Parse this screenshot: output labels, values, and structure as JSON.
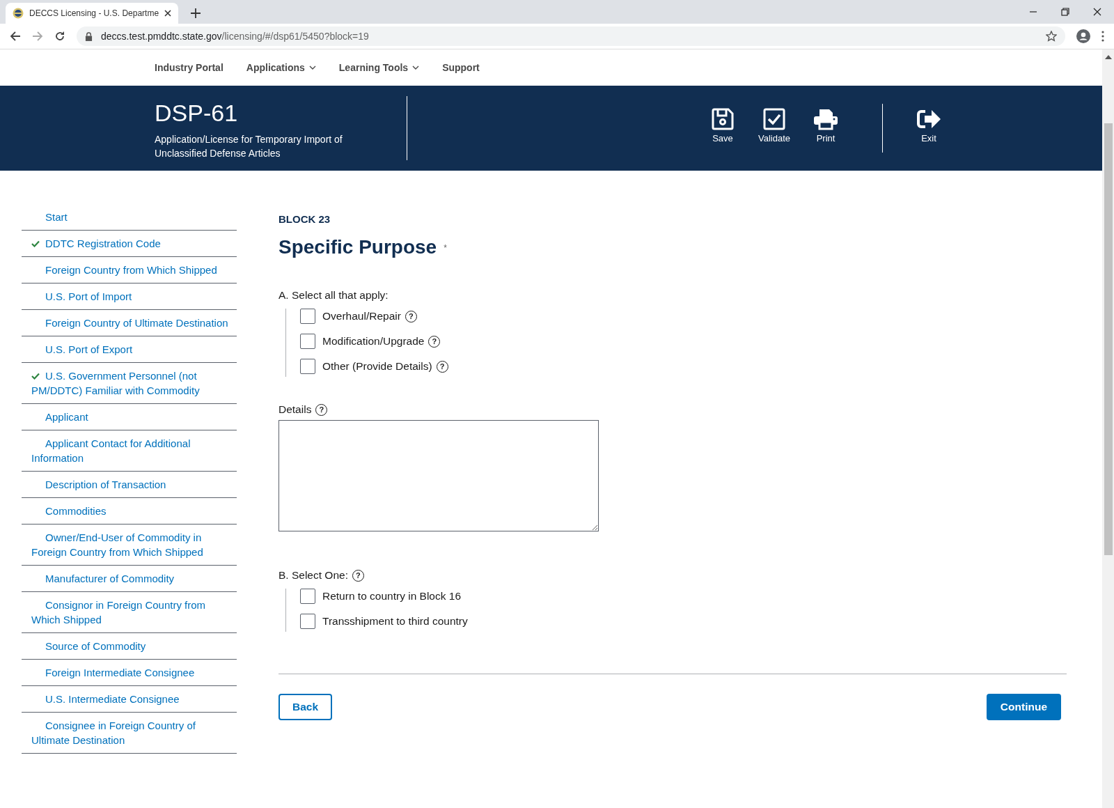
{
  "browser": {
    "tab_title": "DECCS Licensing - U.S. Departme",
    "url_host": "deccs.test.pmddtc.state.gov",
    "url_path": "/licensing/#/dsp61/5450?block=19"
  },
  "nav": [
    {
      "label": "Industry Portal",
      "dropdown": false
    },
    {
      "label": "Applications",
      "dropdown": true
    },
    {
      "label": "Learning Tools",
      "dropdown": true
    },
    {
      "label": "Support",
      "dropdown": false
    }
  ],
  "header": {
    "form": "DSP-61",
    "subtitle": "Application/License for Temporary Import of Unclassified Defense Articles",
    "actions": [
      {
        "kind": "save",
        "label": "Save"
      },
      {
        "kind": "validate",
        "label": "Validate"
      },
      {
        "kind": "print",
        "label": "Print"
      }
    ],
    "exit": {
      "kind": "exit",
      "label": "Exit"
    }
  },
  "sidebar": {
    "items": [
      {
        "label": "Start",
        "checked": false
      },
      {
        "label": "DDTC Registration Code",
        "checked": true
      },
      {
        "label": "Foreign Country from Which Shipped",
        "checked": false
      },
      {
        "label": "U.S. Port of Import",
        "checked": false
      },
      {
        "label": "Foreign Country of Ultimate Destination",
        "checked": false
      },
      {
        "label": "U.S. Port of Export",
        "checked": false
      },
      {
        "label": "U.S. Government Personnel (not PM/DDTC) Familiar with Commodity",
        "checked": true
      },
      {
        "label": "Applicant",
        "checked": false
      },
      {
        "label": "Applicant Contact for Additional Information",
        "checked": false
      },
      {
        "label": "Description of Transaction",
        "checked": false
      },
      {
        "label": "Commodities",
        "checked": false
      },
      {
        "label": "Owner/End-User of Commodity in Foreign Country from Which Shipped",
        "checked": false
      },
      {
        "label": "Manufacturer of Commodity",
        "checked": false
      },
      {
        "label": "Consignor in Foreign Country from Which Shipped",
        "checked": false
      },
      {
        "label": "Source of Commodity",
        "checked": false
      },
      {
        "label": "Foreign Intermediate Consignee",
        "checked": false
      },
      {
        "label": "U.S. Intermediate Consignee",
        "checked": false
      },
      {
        "label": "Consignee in Foreign Country of Ultimate Destination",
        "checked": false
      }
    ]
  },
  "form": {
    "block": "BLOCK 23",
    "title": "Specific Purpose",
    "required_mark": "*",
    "section_a": {
      "label": "A. Select all that apply:",
      "options": [
        {
          "label": "Overhaul/Repair",
          "checked": false,
          "help": "?"
        },
        {
          "label": "Modification/Upgrade",
          "checked": false,
          "help": "?"
        },
        {
          "label": "Other (Provide Details)",
          "checked": false,
          "help": "?"
        }
      ]
    },
    "details": {
      "label": "Details",
      "help": "?"
    },
    "section_b": {
      "label": "B. Select One:",
      "help": "?",
      "options": [
        {
          "label": "Return to country in Block 16",
          "checked": false
        },
        {
          "label": "Transshipment to third country",
          "checked": false
        }
      ]
    },
    "back": "Back",
    "continue": "Continue"
  }
}
